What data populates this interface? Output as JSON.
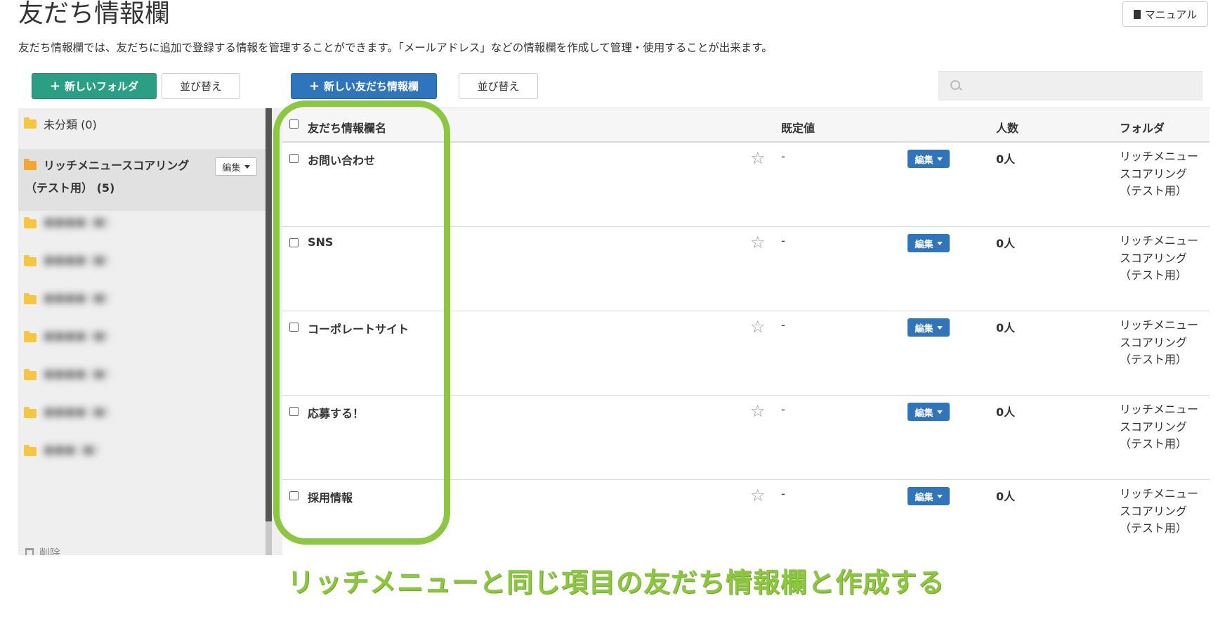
{
  "header": {
    "title": "友だち情報欄",
    "manual_label": "マニュアル",
    "description": "友だち情報欄では、友だちに追加で登録する情報を管理することができます。「メールアドレス」などの情報欄を作成して管理・使用することが出来ます。"
  },
  "toolbar": {
    "new_folder_label": "新しいフォルダ",
    "sort_folders_label": "並び替え",
    "new_field_label": "新しい友だち情報欄",
    "sort_fields_label": "並び替え",
    "search_placeholder": ""
  },
  "sidebar": {
    "uncategorized": "未分類 (0)",
    "selected_folder_line1": "リッチメニュースコアリング",
    "selected_folder_line2": "（テスト用） (5)",
    "edit_label": "編集",
    "blurred_folders": [
      "■■■■ (■)",
      "■■■■ (■)",
      "■■■■ (■)",
      "■■■■ (■)",
      "■■■■ (■)",
      "■■■■ (■)",
      "■■■ (■)"
    ],
    "trash_label": "削除"
  },
  "table": {
    "columns": {
      "name": "友だち情報欄名",
      "default": "既定値",
      "count": "人数",
      "folder": "フォルダ"
    },
    "edit_label": "編集",
    "rows": [
      {
        "name": "お問い合わせ",
        "star": "☆",
        "default": "-",
        "count": "0人",
        "folder": "リッチメニュースコアリング（テスト用）"
      },
      {
        "name": "SNS",
        "star": "☆",
        "default": "-",
        "count": "0人",
        "folder": "リッチメニュースコアリング（テスト用）"
      },
      {
        "name": "コーポレートサイト",
        "star": "☆",
        "default": "-",
        "count": "0人",
        "folder": "リッチメニュースコアリング（テスト用）"
      },
      {
        "name": "応募する！",
        "star": "☆",
        "default": "-",
        "count": "0人",
        "folder": "リッチメニュースコアリング（テスト用）"
      },
      {
        "name": "採用情報",
        "star": "☆",
        "default": "-",
        "count": "0人",
        "folder": "リッチメニュースコアリング（テスト用）"
      }
    ]
  },
  "caption": "リッチメニューと同じ項目の友だち情報欄と作成する",
  "colors": {
    "green_button": "#2b9f83",
    "blue_button": "#2e75bb",
    "highlight": "#8dc63f",
    "folder": "#f6c542"
  }
}
